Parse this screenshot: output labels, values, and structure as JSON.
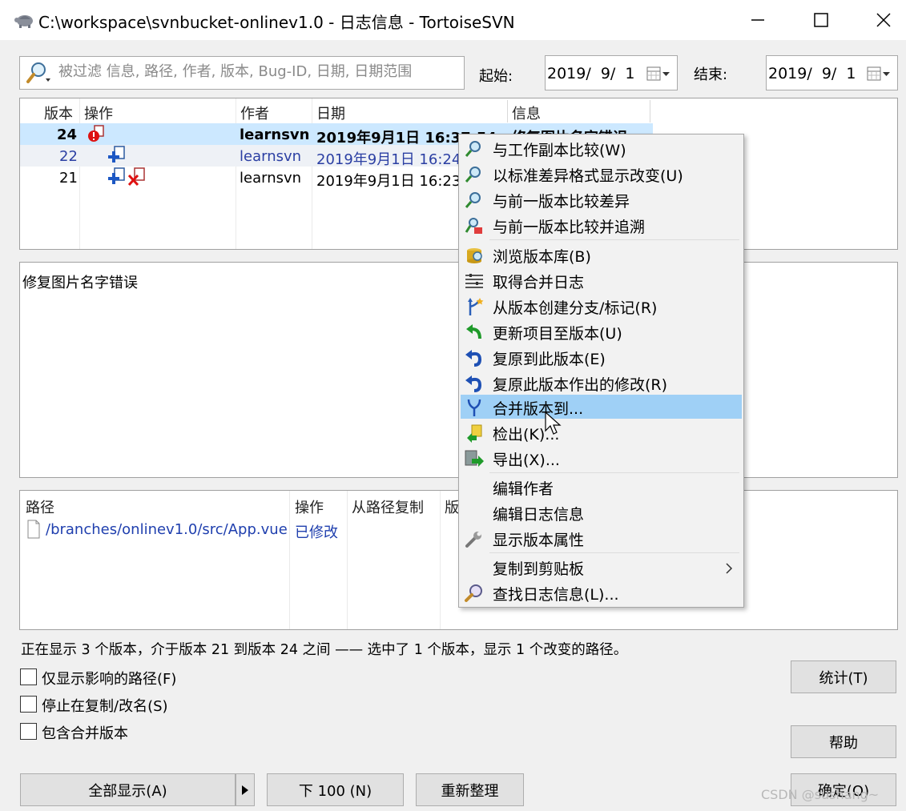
{
  "window": {
    "title": "C:\\workspace\\svnbucket-onlinev1.0 - 日志信息 - TortoiseSVN",
    "minimize_glyph": "—",
    "maximize_glyph": "☐",
    "close_glyph": "✕"
  },
  "filter": {
    "placeholder": "被过滤 信息, 路径, 作者, 版本, Bug-ID, 日期, 日期范围",
    "start_label": "起始:",
    "start_date": "2019/  9/  1",
    "end_label": "结束:",
    "end_date": "2019/  9/  1"
  },
  "revlist": {
    "columns": [
      "版本",
      "操作",
      "作者",
      "日期",
      "信息"
    ],
    "rows": [
      {
        "revision": "24",
        "author": "learnsvn",
        "date": "2019年9月1日 16:37:54",
        "message": "修复图片名字错误"
      },
      {
        "revision": "22",
        "author": "learnsvn",
        "date": "2019年9月1日 16:24"
      },
      {
        "revision": "21",
        "author": "learnsvn",
        "date": "2019年9月1日 16:23"
      }
    ]
  },
  "message_pane": {
    "text": "修复图片名字错误"
  },
  "paths": {
    "columns": [
      "路径",
      "操作",
      "从路径复制",
      "版"
    ],
    "rows": [
      {
        "path": "/branches/onlinev1.0/src/App.vue",
        "action": "已修改"
      }
    ]
  },
  "status_text": "正在显示 3 个版本，介于版本 21 到版本 24 之间 —— 选中了 1 个版本，显示 1 个改变的路径。",
  "options": {
    "affected_paths": "仅显示影响的路径(F)",
    "stop_on_copy": "停止在复制/改名(S)",
    "include_merged": "包含合并版本"
  },
  "buttons": {
    "statistics": "统计(T)",
    "help": "帮助",
    "show_all": "全部显示(A)",
    "next_100": "下 100 (N)",
    "refresh": "重新整理",
    "ok": "确定(O)"
  },
  "context_menu": {
    "items": [
      {
        "label": "与工作副本比较(W)",
        "icon": "magnifier-icon"
      },
      {
        "label": "以标准差异格式显示改变(U)",
        "icon": "magnifier-icon"
      },
      {
        "label": "与前一版本比较差异",
        "icon": "magnifier-icon"
      },
      {
        "label": "与前一版本比较并追溯",
        "icon": "blame-icon"
      },
      {
        "label": "浏览版本库(B)",
        "icon": "repo-browser-icon"
      },
      {
        "label": "取得合并日志",
        "icon": "merge-log-icon"
      },
      {
        "label": "从版本创建分支/标记(R)",
        "icon": "branch-icon"
      },
      {
        "label": "更新项目至版本(U)",
        "icon": "update-arrow-icon"
      },
      {
        "label": "复原到此版本(E)",
        "icon": "revert-icon"
      },
      {
        "label": "复原此版本作出的修改(R)",
        "icon": "revert-icon"
      },
      {
        "label": "合并版本到...",
        "icon": "merge-icon"
      },
      {
        "label": "检出(K)...",
        "icon": "checkout-icon"
      },
      {
        "label": "导出(X)...",
        "icon": "export-icon"
      },
      {
        "label": "编辑作者",
        "icon": ""
      },
      {
        "label": "编辑日志信息",
        "icon": ""
      },
      {
        "label": "显示版本属性",
        "icon": "wrench-icon"
      },
      {
        "label": "复制到剪贴板",
        "icon": ""
      },
      {
        "label": "查找日志信息(L)...",
        "icon": "search-icon"
      }
    ],
    "highlight_color": "#9fd0f6"
  },
  "watermark": "CSDN @sushang~"
}
